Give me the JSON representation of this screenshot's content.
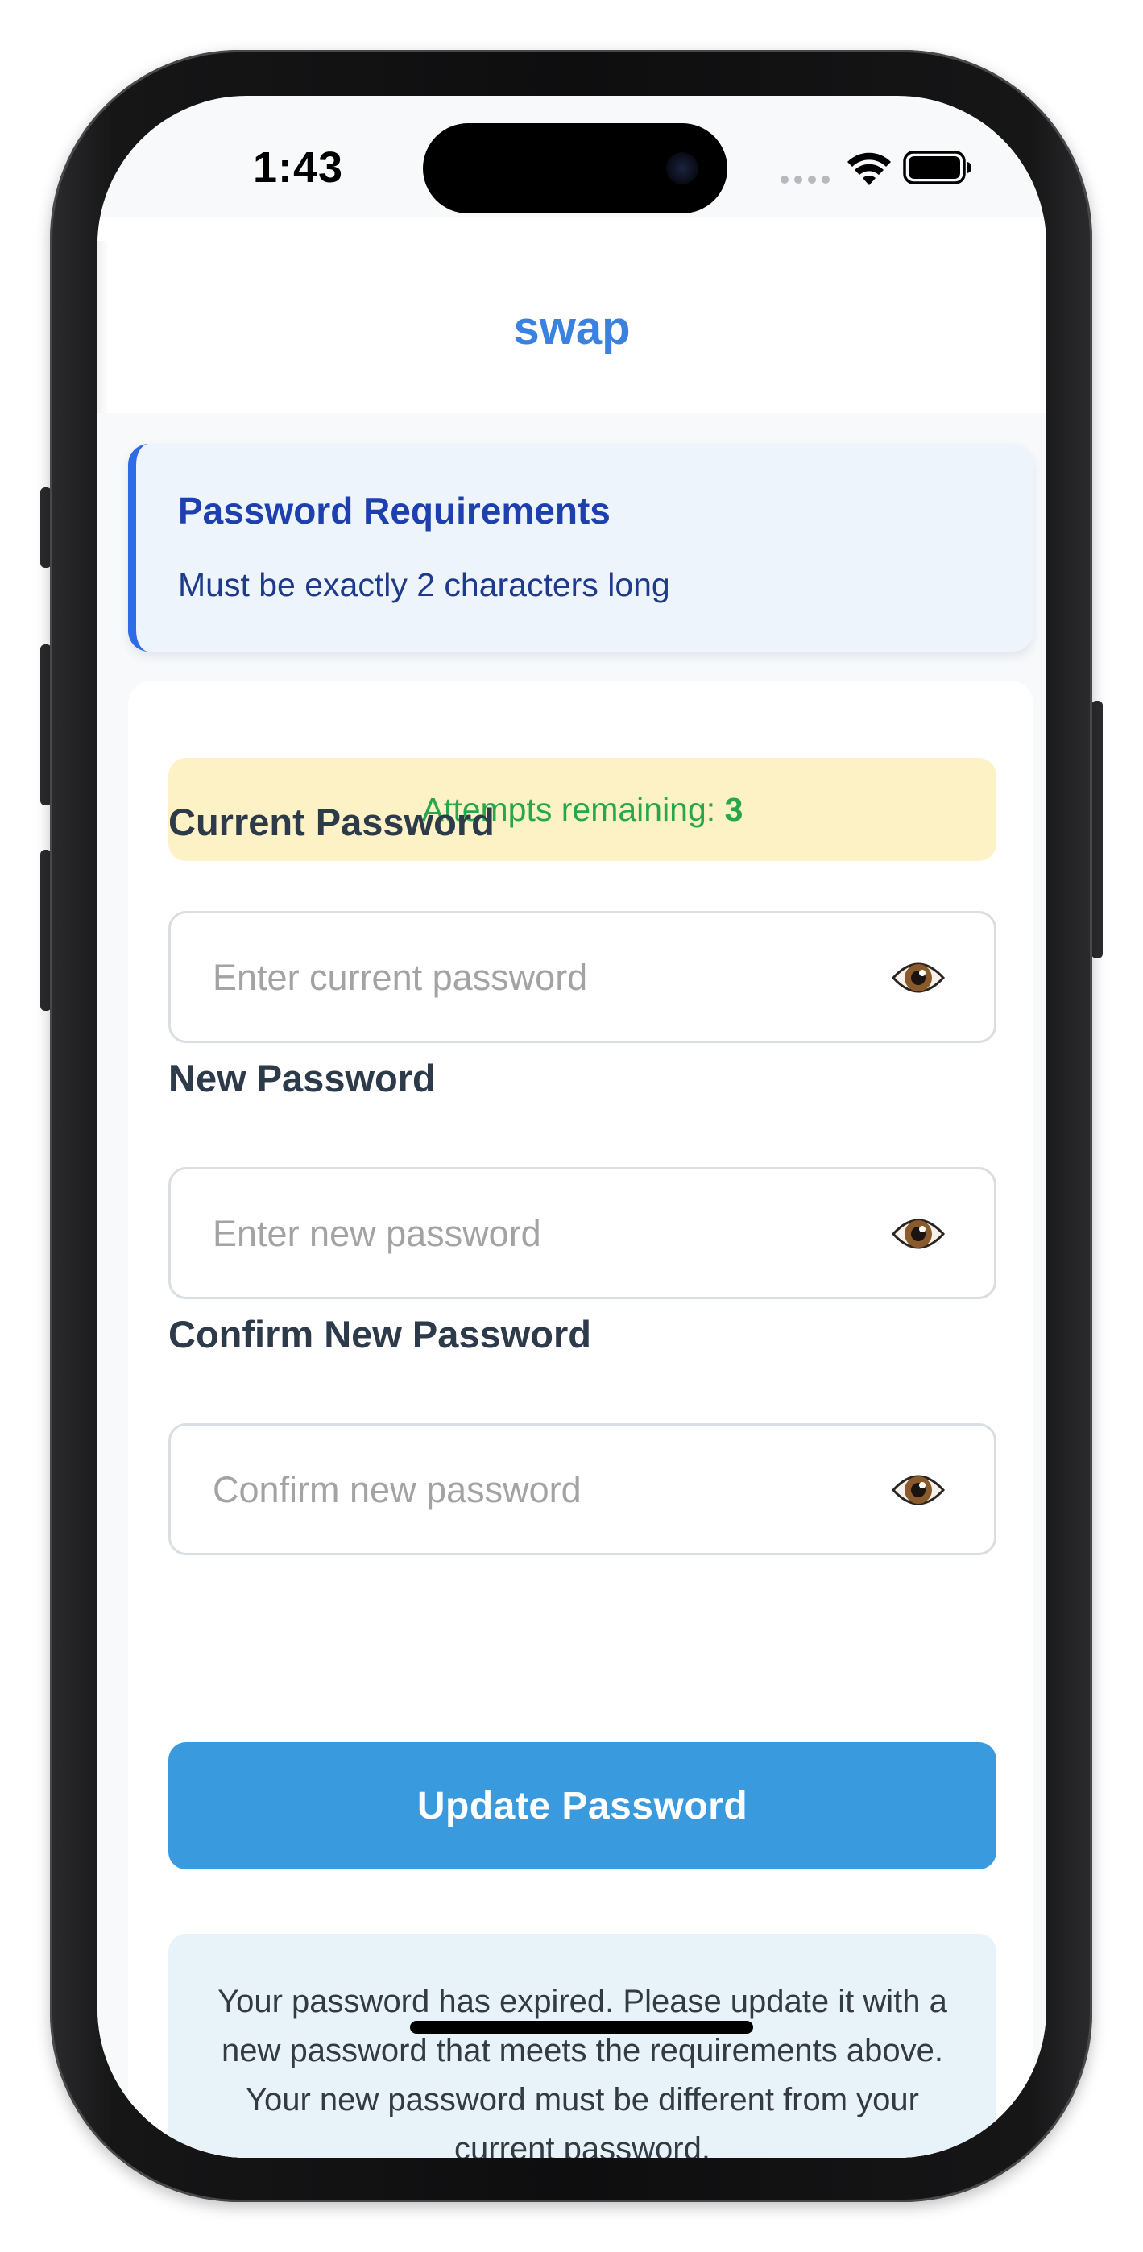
{
  "status_bar": {
    "time": "1:43"
  },
  "app": {
    "title": "swap"
  },
  "requirements": {
    "title": "Password Requirements",
    "text": "Must be exactly 2 characters long",
    "accent_color": "#2e6be6"
  },
  "attempts": {
    "label": "Attempts remaining:",
    "count": "3",
    "text_color": "#27a64c",
    "background": "#fdf2c6"
  },
  "fields": [
    {
      "label": "Current Password",
      "placeholder": "Enter current password",
      "value": "",
      "toggle_icon": "eye-icon"
    },
    {
      "label": "New Password",
      "placeholder": "Enter new password",
      "value": "",
      "toggle_icon": "eye-icon"
    },
    {
      "label": "Confirm New Password",
      "placeholder": "Confirm new password",
      "value": "",
      "toggle_icon": "eye-icon"
    }
  ],
  "submit": {
    "label": "Update Password",
    "color": "#3a9ade"
  },
  "notice": {
    "text": "Your password has expired. Please update it with a new password that meets the requirements above. Your new password must be different from your current password."
  }
}
